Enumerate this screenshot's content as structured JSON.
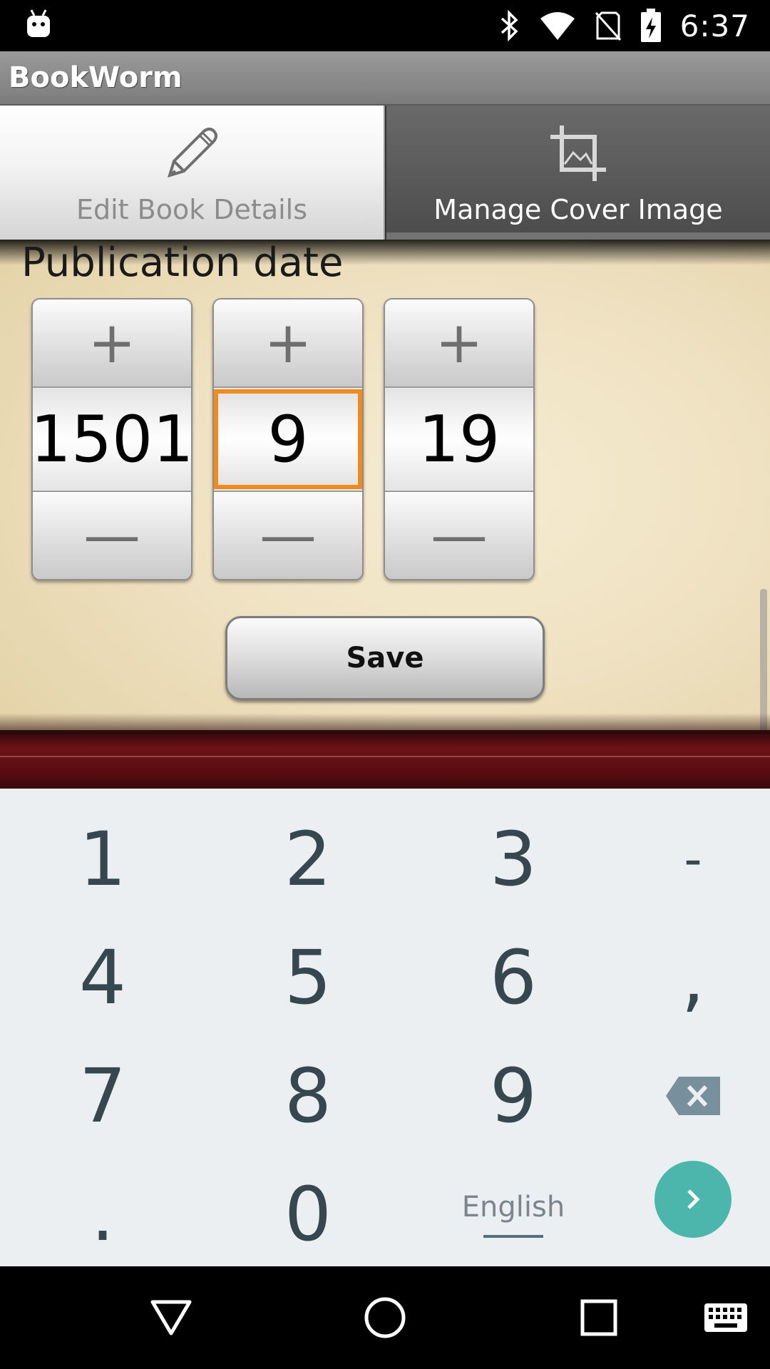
{
  "status_bar": {
    "time": "6:37",
    "icons": [
      "android-icon",
      "bluetooth-icon",
      "wifi-icon",
      "no-sim-icon",
      "battery-charging-icon"
    ]
  },
  "app": {
    "title": "BookWorm"
  },
  "tabs": [
    {
      "label": "Edit Book Details",
      "icon": "pencil-icon",
      "selected": true
    },
    {
      "label": "Manage Cover Image",
      "icon": "crop-icon",
      "selected": false
    }
  ],
  "form": {
    "section_label": "Publication date",
    "pickers": [
      {
        "name": "year",
        "value": "1501",
        "plus": "+",
        "minus": "—"
      },
      {
        "name": "month",
        "value": "9",
        "plus": "+",
        "minus": "—",
        "focused": true
      },
      {
        "name": "day",
        "value": "19",
        "plus": "+",
        "minus": "—"
      }
    ],
    "save_label": "Save"
  },
  "keyboard": {
    "rows": [
      [
        "1",
        "2",
        "3",
        "-"
      ],
      [
        "4",
        "5",
        "6",
        ","
      ],
      [
        "7",
        "8",
        "9",
        "backspace"
      ],
      [
        ".",
        "0",
        "English",
        "go"
      ]
    ],
    "language": "English",
    "accent": "#4db6ac"
  },
  "navbar": {
    "buttons": [
      "back-icon",
      "home-icon",
      "recents-icon",
      "keyboard-icon"
    ]
  }
}
